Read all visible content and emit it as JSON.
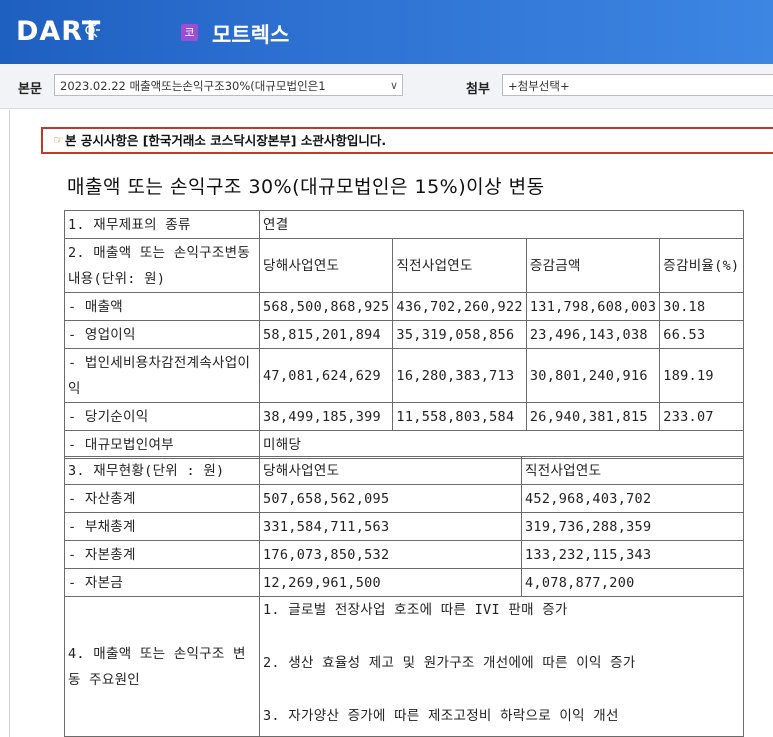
{
  "header": {
    "logo": "DART",
    "company_badge": "코",
    "company_name": "모트렉스"
  },
  "toolbar": {
    "body_label": "본문",
    "body_select": "2023.02.22  매출액또는손익구조30%(대규모법인은1",
    "attach_label": "첨부",
    "attach_select": "+첨부선택+"
  },
  "notice": {
    "text": "본 공시사항은 [한국거래소 코스닥시장본부] 소관사항입니다."
  },
  "document": {
    "title": "매출액 또는 손익구조 30%(대규모법인은 15%)이상 변동"
  },
  "table": {
    "r1": {
      "label": "1. 재무제표의 종류",
      "value": "연결"
    },
    "r2": {
      "label": "2. 매출액 또는 손익구조변동내용(단위: 원)",
      "h1": "당해사업연도",
      "h2": "직전사업연도",
      "h3": "증감금액",
      "h4": "증감비율(%)"
    },
    "sales": {
      "label": "- 매출액",
      "cur": "568,500,868,925",
      "prev": "436,702,260,922",
      "diff": "131,798,608,003",
      "rate": "30.18"
    },
    "op": {
      "label": "- 영업이익",
      "cur": "58,815,201,894",
      "prev": "35,319,058,856",
      "diff": "23,496,143,038",
      "rate": "66.53"
    },
    "pretax": {
      "label": "- 법인세비용차감전계속사업이익",
      "cur": "47,081,624,629",
      "prev": "16,280,383,713",
      "diff": "30,801,240,916",
      "rate": "189.19"
    },
    "net": {
      "label": "- 당기순이익",
      "cur": "38,499,185,399",
      "prev": "11,558,803,584",
      "diff": "26,940,381,815",
      "rate": "233.07"
    },
    "large": {
      "label": "- 대규모법인여부",
      "value": "미해당"
    },
    "r3": {
      "label": "3. 재무현황(단위 : 원)",
      "h1": "당해사업연도",
      "h2": "직전사업연도"
    },
    "assets": {
      "label": "- 자산총계",
      "cur": "507,658,562,095",
      "prev": "452,968,403,702"
    },
    "liab": {
      "label": "- 부채총계",
      "cur": "331,584,711,563",
      "prev": "319,736,288,359"
    },
    "equity": {
      "label": "- 자본총계",
      "cur": "176,073,850,532",
      "prev": "133,232,115,343"
    },
    "capital": {
      "label": "- 자본금",
      "cur": "12,269,961,500",
      "prev": "4,078,877,200"
    },
    "r4": {
      "label": "4. 매출액 또는 손익구조 변동 주요원인",
      "line1": "1. 글로벌 전장사업 호조에 따른 IVI 판매 증가",
      "line2": "2. 생산 효율성 제고 및 원가구조 개선에에 따른 이익 증가",
      "line3": "3. 자가양산 증가에 따른 제조고정비 하락으로 이익 개선"
    }
  }
}
